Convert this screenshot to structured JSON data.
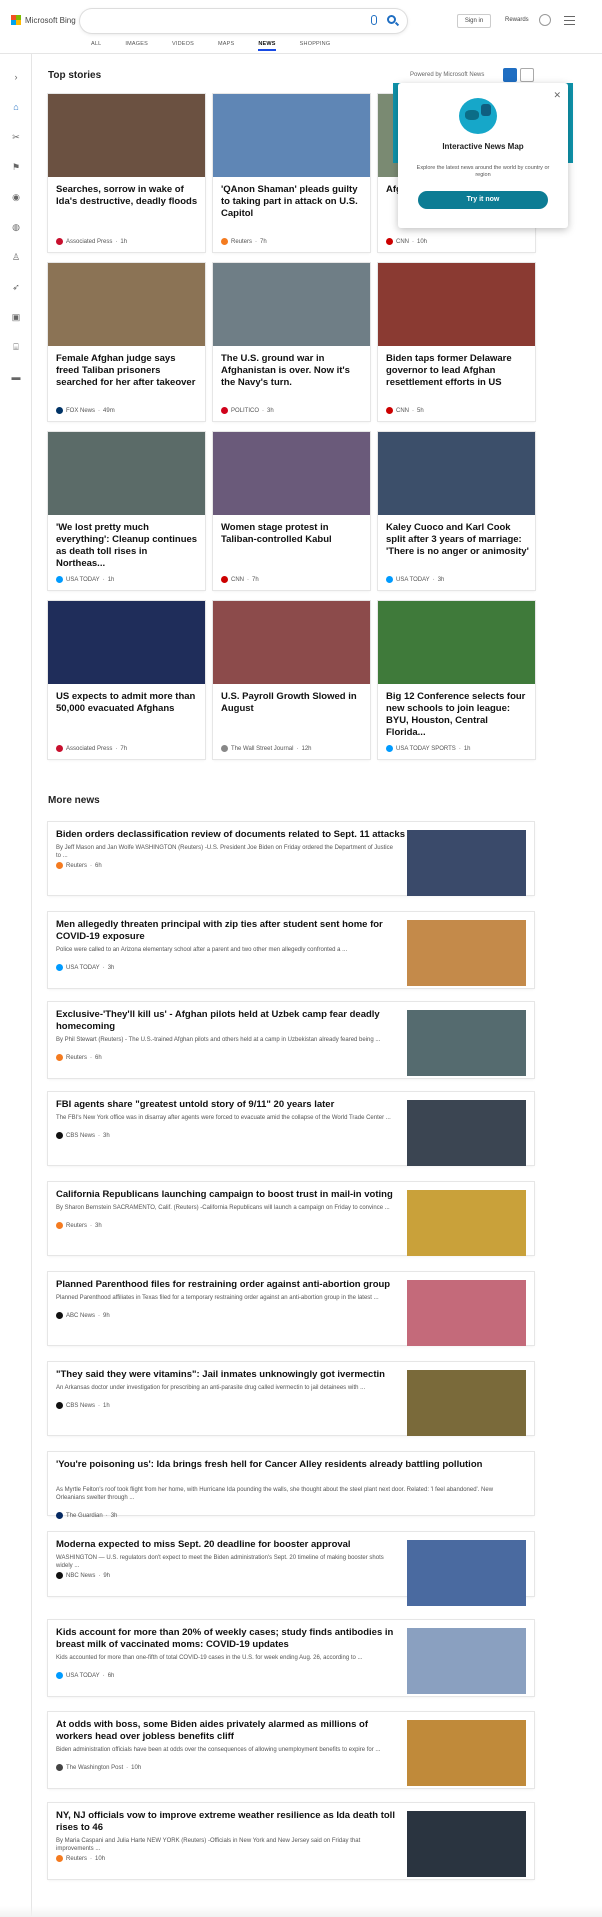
{
  "header": {
    "brand": "Microsoft Bing",
    "signin_label": "Sign in",
    "rewards_label": "Rewards",
    "tabs": [
      "ALL",
      "IMAGES",
      "VIDEOS",
      "MAPS",
      "NEWS",
      "SHOPPING"
    ],
    "active_tab": "NEWS",
    "accent": "#174ae4"
  },
  "top_stories": {
    "title": "Top stories",
    "powered_by": "Powered by Microsoft News",
    "cards": [
      {
        "title": "Searches, sorrow in wake of Ida's destructive, deadly floods",
        "source": "Associated Press",
        "age": "1h",
        "logo": "#c8102e",
        "img": "#6b5141"
      },
      {
        "title": "'QAnon Shaman' pleads guilty to taking part in attack on U.S. Capitol",
        "source": "Reuters",
        "age": "7h",
        "logo": "#f47b20",
        "img": "#5f86b5"
      },
      {
        "title": "Afghan … erupt … Taliban",
        "source": "CNN",
        "age": "10h",
        "logo": "#cc0000",
        "img": "#7a8a72"
      },
      {
        "title": "Female Afghan judge says freed Taliban prisoners searched for her after takeover",
        "source": "FOX News",
        "age": "49m",
        "logo": "#003366",
        "img": "#8b7355"
      },
      {
        "title": "The U.S. ground war in Afghanistan is over. Now it's the Navy's turn.",
        "source": "POLITICO",
        "age": "3h",
        "logo": "#d0021b",
        "img": "#6f7e86"
      },
      {
        "title": "Biden taps former Delaware governor to lead Afghan resettlement efforts in US",
        "source": "CNN",
        "age": "5h",
        "logo": "#cc0000",
        "img": "#8a3a32"
      },
      {
        "title": "'We lost pretty much everything': Cleanup continues as death toll rises in Northeas...",
        "source": "USA TODAY",
        "age": "1h",
        "logo": "#009bff",
        "img": "#5b6b68"
      },
      {
        "title": "Women stage protest in Taliban-controlled Kabul",
        "source": "CNN",
        "age": "7h",
        "logo": "#cc0000",
        "img": "#6a5a7a"
      },
      {
        "title": "Kaley Cuoco and Karl Cook split after 3 years of marriage: 'There is no anger or animosity'",
        "source": "USA TODAY",
        "age": "3h",
        "logo": "#009bff",
        "img": "#3c4f6a"
      },
      {
        "title": "US expects to admit more than 50,000 evacuated Afghans",
        "source": "Associated Press",
        "age": "7h",
        "logo": "#c8102e",
        "img": "#1f2d5a"
      },
      {
        "title": "U.S. Payroll Growth Slowed in August",
        "source": "The Wall Street Journal",
        "age": "12h",
        "logo": "#888888",
        "img": "#8c4b4b"
      },
      {
        "title": "Big 12 Conference selects four new schools to join league: BYU, Houston, Central Florida...",
        "source": "USA TODAY SPORTS",
        "age": "1h",
        "logo": "#009bff",
        "img": "#3f7a3a"
      }
    ]
  },
  "popup": {
    "title": "Interactive News Map",
    "description": "Explore the latest news around the world by country or region",
    "button": "Try it now"
  },
  "more_news": {
    "title": "More news",
    "items": [
      {
        "title": "Biden orders declassification review of documents related to Sept. 11 attacks",
        "snippet": "By Jeff Mason and Jan Wolfe WASHINGTON (Reuters) -U.S. President Joe Biden on Friday ordered the Department of Justice to ...",
        "source": "Reuters",
        "age": "6h",
        "logo": "#f47b20",
        "img": "#3a4a6a"
      },
      {
        "title": "Men allegedly threaten principal with zip ties after student sent home for COVID-19 exposure",
        "snippet": "Police were called to an Arizona elementary school after a parent and two other men allegedly confronted a ...",
        "source": "USA TODAY",
        "age": "3h",
        "logo": "#009bff",
        "img": "#c48a4a"
      },
      {
        "title": "Exclusive-'They'll kill us' - Afghan pilots held at Uzbek camp fear deadly homecoming",
        "snippet": "By Phil Stewart (Reuters) - The U.S.-trained Afghan pilots and others held at a camp in Uzbekistan already feared being ...",
        "source": "Reuters",
        "age": "6h",
        "logo": "#f47b20",
        "img": "#556b6f"
      },
      {
        "title": "FBI agents share \"greatest untold story of 9/11\" 20 years later",
        "snippet": "The FBI's New York office was in disarray after agents were forced to evacuate amid the collapse of the World Trade Center ...",
        "source": "CBS News",
        "age": "3h",
        "logo": "#111111",
        "img": "#3b4552"
      },
      {
        "title": "California Republicans launching campaign to boost trust in mail-in voting",
        "snippet": "By Sharon Bernstein SACRAMENTO, Calif. (Reuters) -California Republicans will launch a campaign on Friday to convince ...",
        "source": "Reuters",
        "age": "3h",
        "logo": "#f47b20",
        "img": "#c9a13a"
      },
      {
        "title": "Planned Parenthood files for restraining order against anti-abortion group",
        "snippet": "Planned Parenthood affiliates in Texas filed for a temporary restraining order against an anti-abortion group in the latest ...",
        "source": "ABC News",
        "age": "9h",
        "logo": "#111111",
        "img": "#c46a7a"
      },
      {
        "title": "\"They said they were vitamins\": Jail inmates unknowingly got ivermectin",
        "snippet": "An Arkansas doctor under investigation for prescribing an anti-parasite drug called ivermectin to jail detainees with ...",
        "source": "CBS News",
        "age": "1h",
        "logo": "#111111",
        "img": "#7a6a3a"
      },
      {
        "title": "'You're poisoning us': Ida brings fresh hell for Cancer Alley residents already battling pollution",
        "snippet": "As Myrtle Felton's roof took flight from her home, with Hurricane Ida pounding the walls, she thought about the steel plant next door. Related: 'I feel abandoned'. New Orleanians swelter through ...",
        "source": "The Guardian",
        "age": "3h",
        "logo": "#052962",
        "img": ""
      },
      {
        "title": "Moderna expected to miss Sept. 20 deadline for booster approval",
        "snippet": "WASHINGTON — U.S. regulators don't expect to meet the Biden administration's Sept. 20 timeline of making booster shots widely ...",
        "source": "NBC News",
        "age": "9h",
        "logo": "#111111",
        "img": "#4a6aa0"
      },
      {
        "title": "Kids account for more than 20% of weekly cases; study finds antibodies in breast milk of vaccinated moms: COVID-19 updates",
        "snippet": "Kids accounted for more than one-fifth of total COVID-19 cases in the U.S. for week ending Aug. 26, according to ...",
        "source": "USA TODAY",
        "age": "6h",
        "logo": "#009bff",
        "img": "#8aa0c0"
      },
      {
        "title": "At odds with boss, some Biden aides privately alarmed as millions of workers head over jobless benefits cliff",
        "snippet": "Biden administration officials have been at odds over the consequences of allowing unemployment benefits to expire for ...",
        "source": "The Washington Post",
        "age": "10h",
        "logo": "#444444",
        "img": "#c08a3a"
      },
      {
        "title": "NY, NJ officials vow to improve extreme weather resilience as Ida death toll rises to 46",
        "snippet": "By Maria Caspani and Julia Harte NEW YORK (Reuters) -Officials in New York and New Jersey said on Friday that improvements ...",
        "source": "Reuters",
        "age": "10h",
        "logo": "#f47b20",
        "img": "#2a3440"
      }
    ]
  }
}
